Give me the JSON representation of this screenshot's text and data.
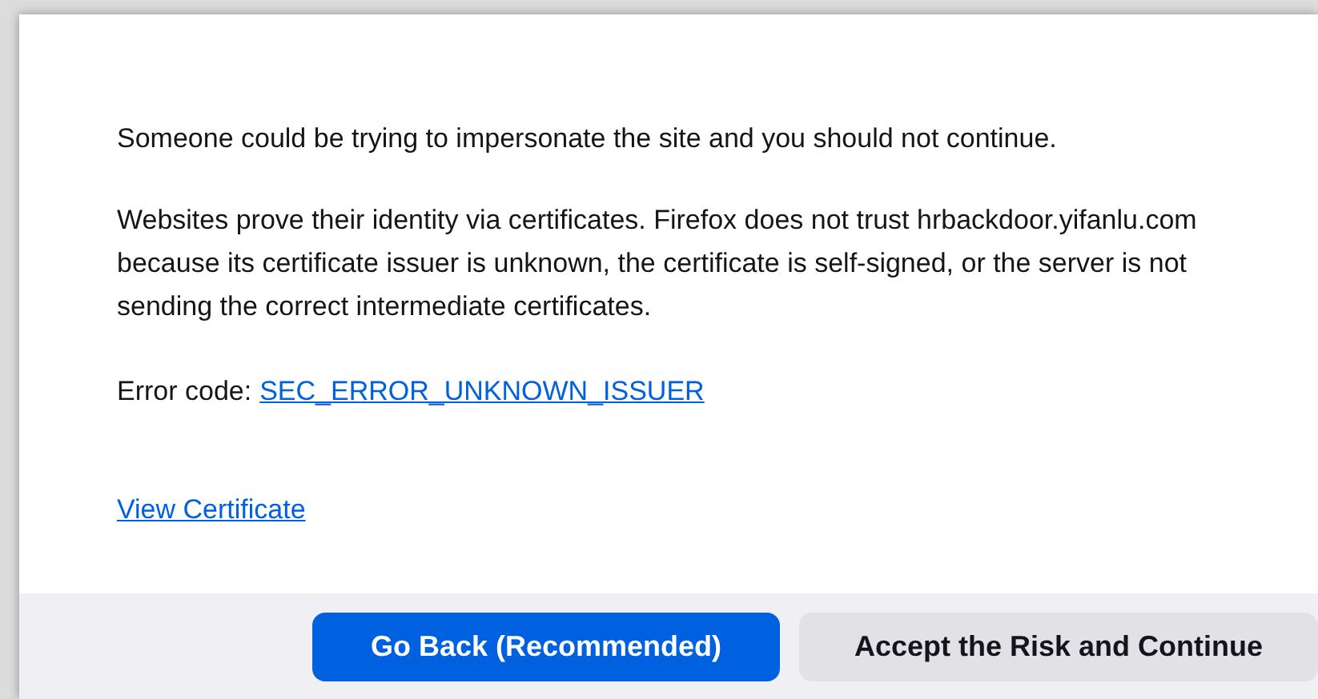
{
  "warning": "Someone could be trying to impersonate the site and you should not continue.",
  "explanation": "Websites prove their identity via certificates. Firefox does not trust hrbackdoor.yifanlu.com because its certificate issuer is unknown, the certificate is self-signed, or the server is not sending the correct intermediate certificates.",
  "error_code": {
    "label": "Error code:",
    "code": "SEC_ERROR_UNKNOWN_ISSUER"
  },
  "view_certificate_link": "View Certificate",
  "buttons": [
    {
      "label": "Go Back (Recommended)",
      "kind": "primary"
    },
    {
      "label": "Accept the Risk and Continue",
      "kind": "secondary"
    }
  ]
}
